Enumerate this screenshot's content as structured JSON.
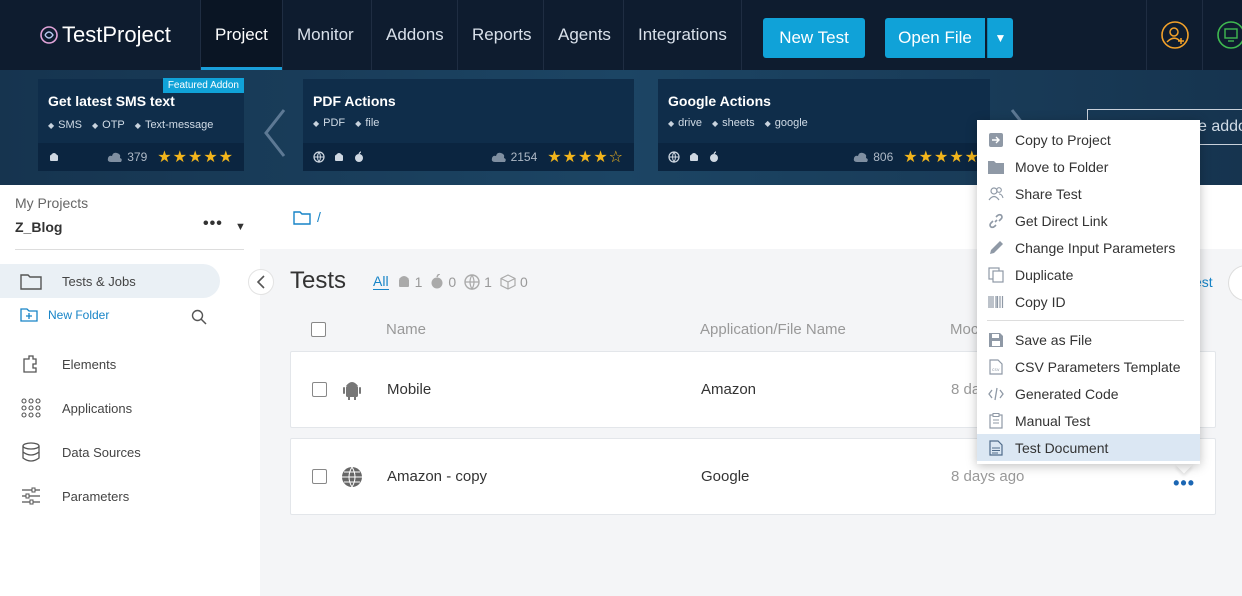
{
  "app": {
    "logo_text": "TestProject"
  },
  "nav": {
    "items": [
      {
        "label": "Project",
        "active": true
      },
      {
        "label": "Monitor"
      },
      {
        "label": "Addons"
      },
      {
        "label": "Reports"
      },
      {
        "label": "Agents"
      },
      {
        "label": "Integrations"
      }
    ],
    "new_test_label": "New Test",
    "open_file_label": "Open File",
    "accent_color": "#10a2d8"
  },
  "banner": {
    "addons": [
      {
        "title": "Get latest SMS text",
        "tags": [
          "SMS",
          "OTP",
          "Text-message"
        ],
        "downloads": "379",
        "rating": "★★★★★",
        "badge": "Featured Addon"
      },
      {
        "title": "PDF Actions",
        "tags": [
          "PDF",
          "file"
        ],
        "downloads": "2154",
        "rating": "★★★★☆"
      },
      {
        "title": "Google Actions",
        "tags": [
          "drive",
          "sheets",
          "google"
        ],
        "downloads": "806",
        "rating": "★★★★★"
      }
    ],
    "search_placeholder": "e addo"
  },
  "sidebar": {
    "my_projects_label": "My Projects",
    "project_name": "Z_Blog",
    "more": "•••",
    "items": [
      {
        "label": "Tests & Jobs",
        "active": true
      },
      {
        "label": "Elements"
      },
      {
        "label": "Applications"
      },
      {
        "label": "Data Sources"
      },
      {
        "label": "Parameters"
      }
    ],
    "new_folder_label": "New Folder"
  },
  "main": {
    "breadcrumb_sep": "/",
    "title": "Tests",
    "filters": {
      "all": "All",
      "android_count": "1",
      "ios_count": "0",
      "web_count": "1",
      "generic_count": "0"
    },
    "test_link_partial": "est",
    "columns": {
      "name": "Name",
      "app": "Application/File Name",
      "modified": "Moc"
    },
    "rows": [
      {
        "name": "Mobile",
        "app": "Amazon",
        "date": "8 da"
      },
      {
        "name": "Amazon - copy",
        "app": "Google",
        "date": "8 days ago",
        "more": "•••"
      }
    ]
  },
  "context_menu": {
    "items": [
      {
        "label": "Copy to Project",
        "icon": "copy-to-project-icon"
      },
      {
        "label": "Move to Folder",
        "icon": "folder-icon"
      },
      {
        "label": "Share Test",
        "icon": "users-icon"
      },
      {
        "label": "Get Direct Link",
        "icon": "link-icon"
      },
      {
        "label": "Change Input Parameters",
        "icon": "pencil-icon"
      },
      {
        "label": "Duplicate",
        "icon": "duplicate-icon"
      },
      {
        "label": "Copy ID",
        "icon": "barcode-icon"
      },
      {
        "label": "Save as File",
        "icon": "save-icon"
      },
      {
        "label": "CSV Parameters Template",
        "icon": "csv-file-icon"
      },
      {
        "label": "Generated Code",
        "icon": "code-icon"
      },
      {
        "label": "Manual Test",
        "icon": "clipboard-icon"
      },
      {
        "label": "Test Document",
        "icon": "document-icon",
        "highlighted": true
      }
    ]
  }
}
